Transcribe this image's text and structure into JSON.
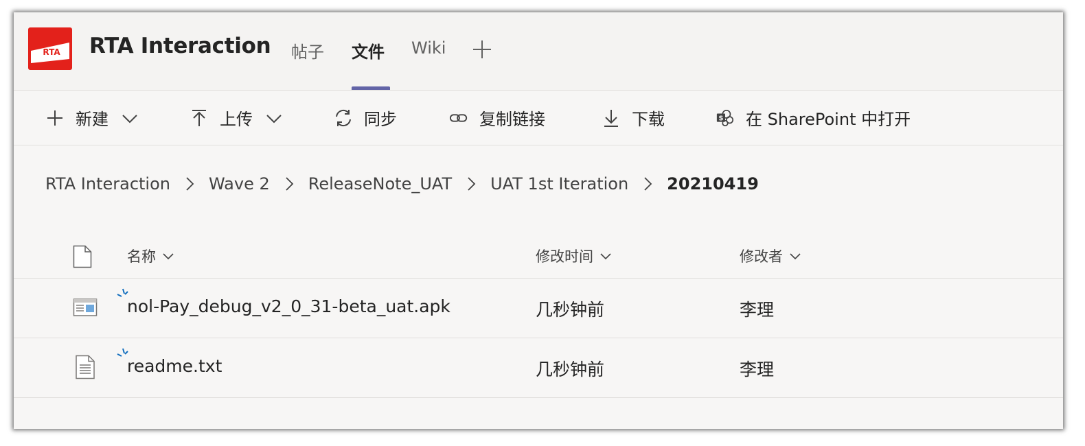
{
  "app": {
    "title": "RTA Interaction",
    "logo_text": "RTA"
  },
  "tabs": [
    {
      "label": "帖子",
      "active": false
    },
    {
      "label": "文件",
      "active": true
    },
    {
      "label": "Wiki",
      "active": false
    }
  ],
  "accent_color": "#6264a7",
  "brand_color": "#e3211b",
  "toolbar": {
    "new_label": "新建",
    "upload_label": "上传",
    "sync_label": "同步",
    "copy_link_label": "复制链接",
    "download_label": "下载",
    "open_sharepoint_label": "在 SharePoint 中打开"
  },
  "breadcrumb": [
    "RTA Interaction",
    "Wave 2",
    "ReleaseNote_UAT",
    "UAT 1st Iteration",
    "20210419"
  ],
  "table": {
    "columns": {
      "name": "名称",
      "modified": "修改时间",
      "modified_by": "修改者"
    },
    "rows": [
      {
        "icon": "apk-file-icon",
        "name": "nol-Pay_debug_v2_0_31-beta_uat.apk",
        "modified": "几秒钟前",
        "modified_by": "李理"
      },
      {
        "icon": "text-file-icon",
        "name": "readme.txt",
        "modified": "几秒钟前",
        "modified_by": "李理"
      }
    ]
  }
}
